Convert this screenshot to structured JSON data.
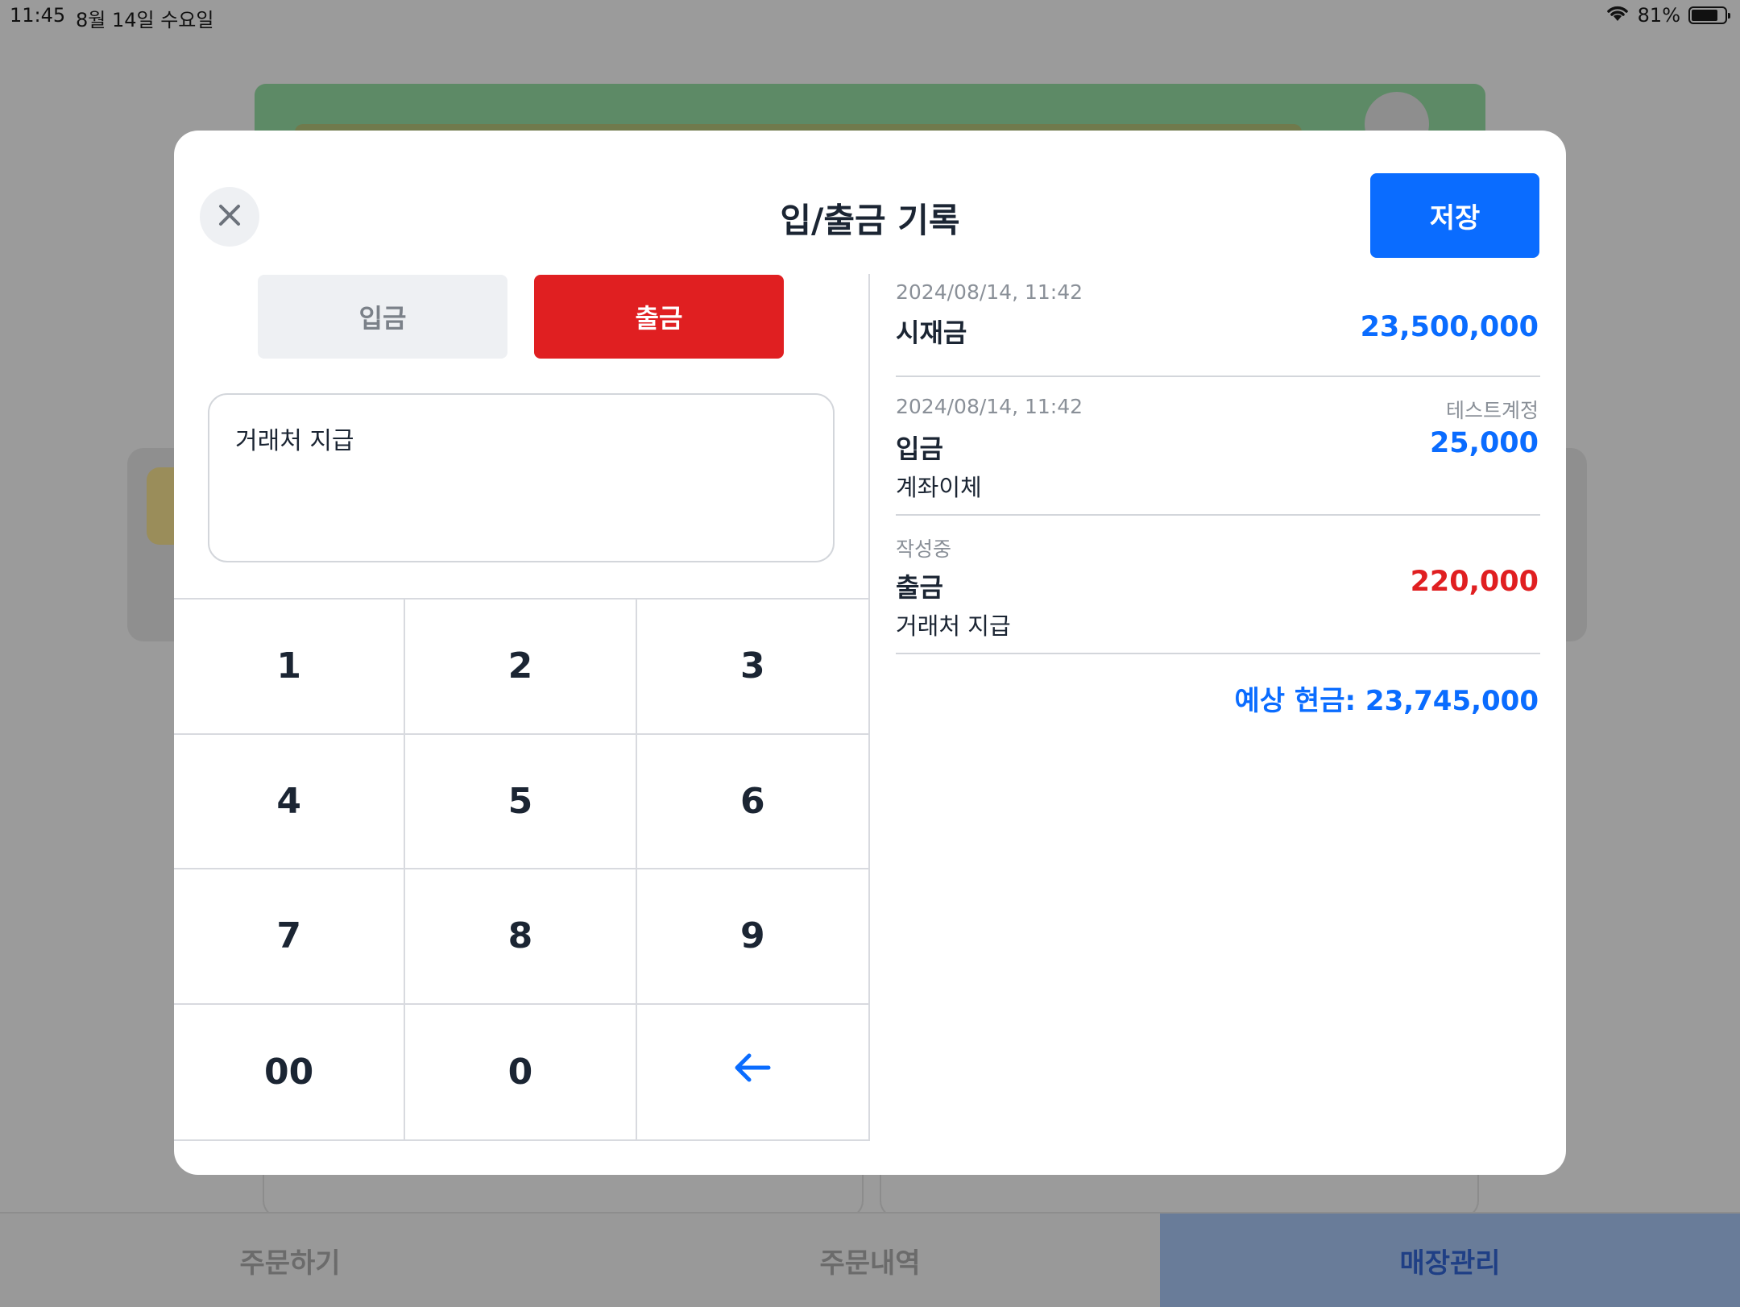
{
  "status_bar": {
    "time": "11:45",
    "date": "8월 14일 수요일",
    "battery": "81%",
    "battery_level": 0.81
  },
  "bottom_tabs": [
    {
      "label": "주문하기",
      "active": false
    },
    {
      "label": "주문내역",
      "active": false
    },
    {
      "label": "매장관리",
      "active": true
    }
  ],
  "modal": {
    "title": "입/출금 기록",
    "save_label": "저장",
    "close_icon": "close-icon",
    "type_toggle": {
      "deposit_label": "입금",
      "withdraw_label": "출금",
      "selected": "출금"
    },
    "memo_value": "거래처 지급",
    "keypad": [
      "1",
      "2",
      "3",
      "4",
      "5",
      "6",
      "7",
      "8",
      "9",
      "00",
      "0"
    ],
    "backspace_icon": "arrow-left-icon"
  },
  "ledger": {
    "entries": [
      {
        "meta": "2024/08/14, 11:42",
        "account": "",
        "name": "시재금",
        "amount": "23,500,000",
        "sub": "",
        "color": "#0a6cff"
      },
      {
        "meta": "2024/08/14, 11:42",
        "account": "테스트계정",
        "name": "입금",
        "amount": "25,000",
        "sub": "계좌이체",
        "color": "#0a6cff"
      },
      {
        "meta": "작성중",
        "account": "",
        "name": "출금",
        "amount": "220,000",
        "sub": "거래처 지급",
        "color": "#e01f21"
      }
    ],
    "expected_cash": "예상 현금: 23,745,000"
  },
  "colors": {
    "primary": "#0a6cff",
    "danger": "#e01f21",
    "text": "#1b2533"
  }
}
